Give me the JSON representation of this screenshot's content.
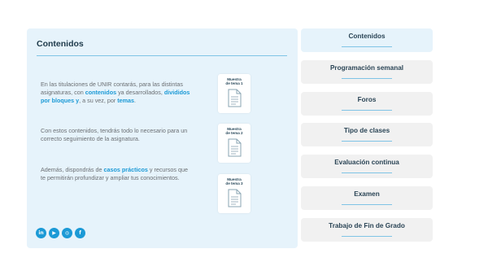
{
  "panel": {
    "title": "Contenidos",
    "paragraphs": [
      {
        "segments": [
          {
            "text": "En las titulaciones de UNIR contarás, para las distintas asignaturas, con ",
            "bold": false
          },
          {
            "text": "contenidos",
            "bold": true
          },
          {
            "text": " ya desarrollados, ",
            "bold": false
          },
          {
            "text": "divididos por bloques y",
            "bold": true
          },
          {
            "text": ", a su vez, por ",
            "bold": false
          },
          {
            "text": "temas",
            "bold": true
          },
          {
            "text": ".",
            "bold": false
          }
        ]
      },
      {
        "segments": [
          {
            "text": "Con estos contenidos, tendrás todo lo necesario para un correcto seguimiento de la asignatura.",
            "bold": false
          }
        ]
      },
      {
        "segments": [
          {
            "text": "Además, dispondrás de ",
            "bold": false
          },
          {
            "text": "casos prácticos",
            "bold": true
          },
          {
            "text": " y recursos que te permitirán profundizar y ampliar tus conocimientos.",
            "bold": false
          }
        ]
      }
    ],
    "samples": [
      {
        "label": "Muestra\nde tema 1"
      },
      {
        "label": "Muestra\nde tema 2"
      },
      {
        "label": "Muestra\nde tema 3"
      }
    ],
    "social": [
      {
        "icon": "linkedin-icon",
        "glyph": "in"
      },
      {
        "icon": "youtube-icon",
        "glyph": "▶"
      },
      {
        "icon": "instagram-icon",
        "glyph": "◎"
      },
      {
        "icon": "facebook-icon",
        "glyph": "f"
      }
    ]
  },
  "menu": {
    "items": [
      {
        "label": "Contenidos",
        "active": true
      },
      {
        "label": "Programación semanal",
        "active": false
      },
      {
        "label": "Foros",
        "active": false
      },
      {
        "label": "Tipo de clases",
        "active": false
      },
      {
        "label": "Evaluación continua",
        "active": false
      },
      {
        "label": "Examen",
        "active": false
      },
      {
        "label": "Trabajo de Fin de Grado",
        "active": false
      }
    ]
  },
  "colors": {
    "accent": "#1c9ad6",
    "panel_bg": "#e6f3fb",
    "menu_bg": "#f1f1f1",
    "rule": "#7fc4e6"
  }
}
